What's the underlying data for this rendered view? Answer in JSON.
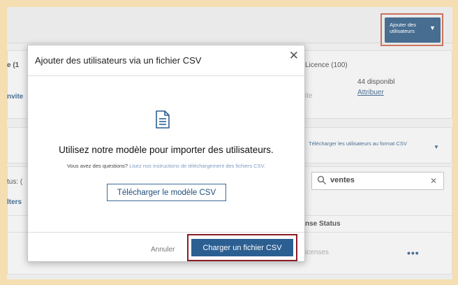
{
  "header": {
    "add_users_button": "Ajouter des utilisateurs"
  },
  "background": {
    "card_a": {
      "title_fragment": "e (1",
      "invite_fragment": "nvite",
      "license_title": "Licence (100)",
      "available": "44 disponibl",
      "assign_link": "Attribuer",
      "fragment_ite": "ite"
    },
    "download_users_csv": "Télécharger les utilisateurs au format CSV",
    "status_fragment": "tus: (",
    "filters_fragment": "lters",
    "search": {
      "value": "ventes"
    },
    "column_license_status": "nse Status",
    "row_licenses_fragment": "icenses"
  },
  "modal": {
    "title": "Ajouter des utilisateurs via un fichier CSV",
    "heading": "Utilisez notre modèle pour importer des utilisateurs.",
    "question_text": "Vous avez des questions?",
    "instructions_link": "Lisez nos instructions de téléchargement des fichiers CSV.",
    "download_template_button": "Télécharger le modèle CSV",
    "cancel_button": "Annuler",
    "upload_button": "Charger un fichier CSV"
  },
  "colors": {
    "primary": "#1f4e79",
    "upload_button": "#2c5f91",
    "outer_highlight": "#c0553a",
    "upload_highlight": "#8b1d24",
    "page_border": "#f5deb1"
  },
  "icons": {
    "file": "file-document-icon",
    "close": "close-icon",
    "search": "search-icon",
    "caret": "caret-down-icon",
    "more": "more-horizontal-icon"
  }
}
